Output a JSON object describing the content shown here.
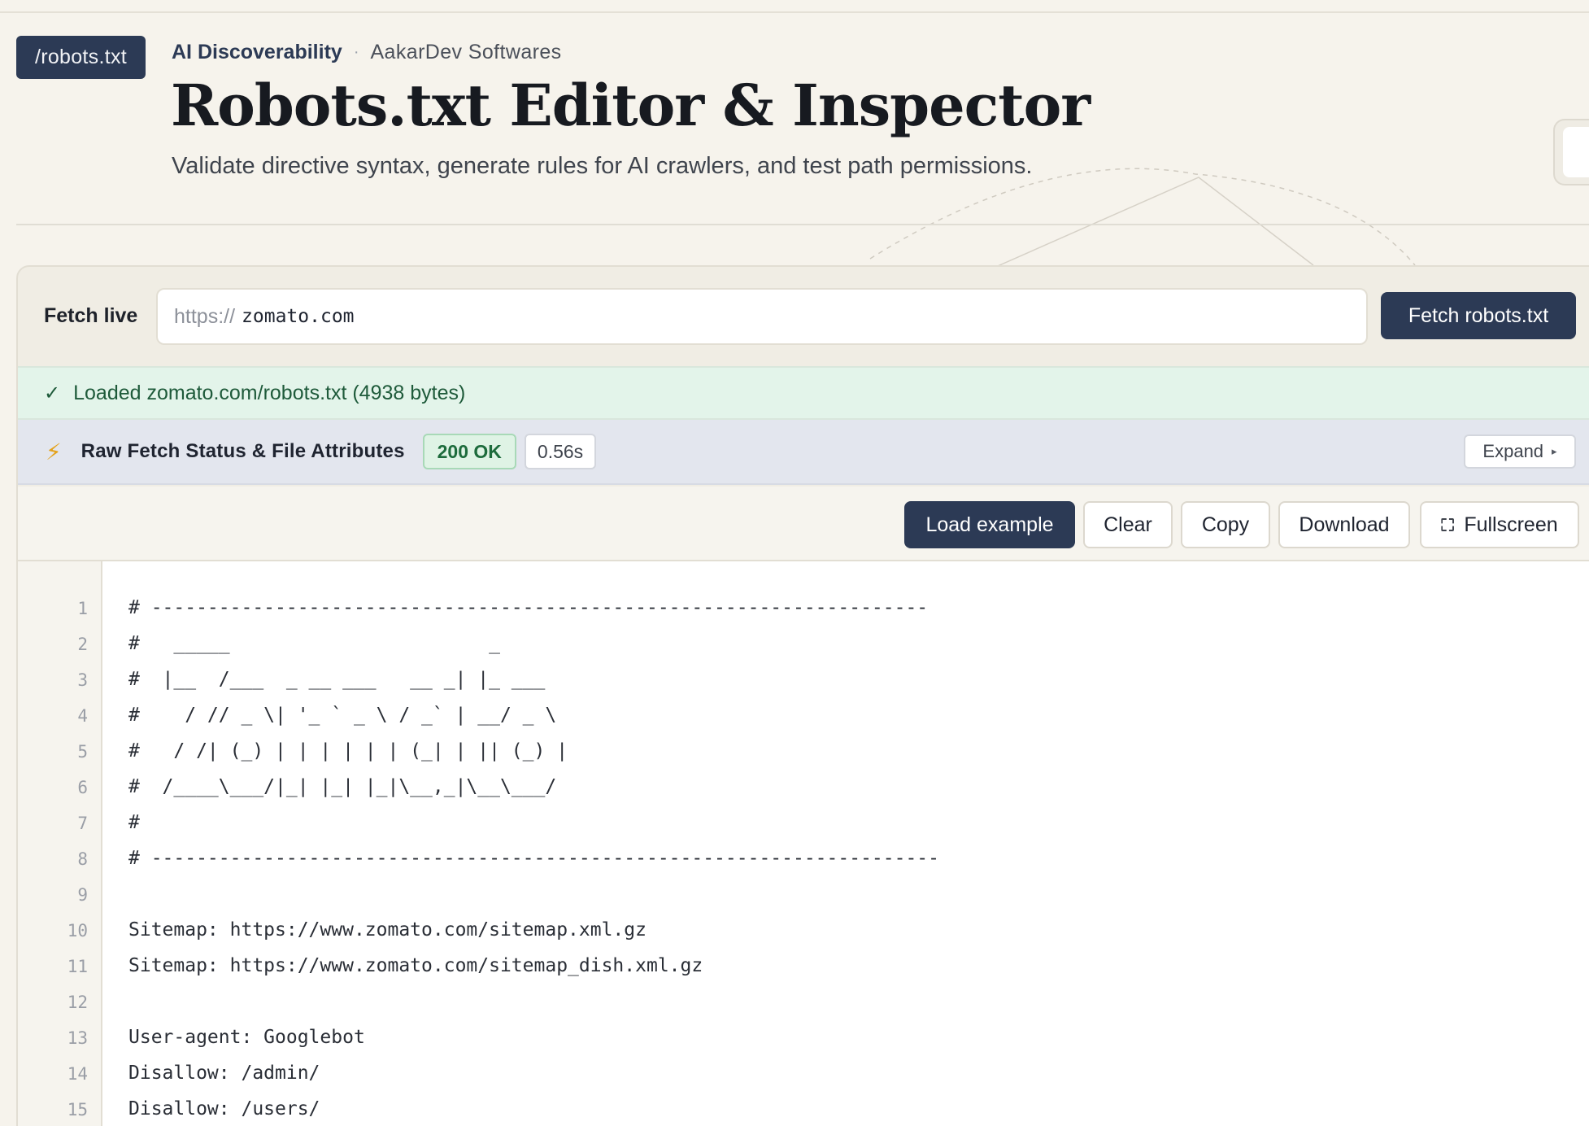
{
  "header": {
    "badge": "/robots.txt",
    "crumb_primary": "AI Discoverability",
    "crumb_separator": "·",
    "crumb_secondary": "AakarDev Softwares",
    "title": "Robots.txt Editor & Inspector",
    "subtitle": "Validate directive syntax, generate rules for AI crawlers, and test path permissions."
  },
  "fetch": {
    "label": "Fetch live",
    "prefix": "https://",
    "value": "zomato.com",
    "button": "Fetch robots.txt"
  },
  "success": {
    "icon": "check-icon",
    "message": "Loaded zomato.com/robots.txt (4938 bytes)"
  },
  "status": {
    "icon": "lightning-bolt-icon",
    "title": "Raw Fetch Status & File Attributes",
    "code": "200 OK",
    "time": "0.56s",
    "expand_label": "Expand",
    "expand_caret": "▸"
  },
  "toolbar": {
    "load_example": "Load example",
    "clear": "Clear",
    "copy": "Copy",
    "download": "Download",
    "fullscreen": "Fullscreen"
  },
  "editor": {
    "line_numbers": [
      "1",
      "2",
      "3",
      "4",
      "5",
      "6",
      "7",
      "8",
      "9",
      "10",
      "11",
      "12",
      "13",
      "14",
      "15"
    ],
    "lines": [
      "# ---------------------------------------------------------------------",
      "#   _____                       _",
      "#  |__  /___  _ __ ___   __ _| |_ ___",
      "#    / // _ \\| '_ ` _ \\ / _` | __/ _ \\",
      "#   / /| (_) | | | | | | (_| | || (_) |",
      "#  /____\\___/|_| |_| |_|\\__,_|\\__\\___/",
      "#",
      "# ----------------------------------------------------------------------",
      "",
      "Sitemap: https://www.zomato.com/sitemap.xml.gz",
      "Sitemap: https://www.zomato.com/sitemap_dish.xml.gz",
      "",
      "User-agent: Googlebot",
      "Disallow: /admin/",
      "Disallow: /users/"
    ]
  },
  "colors": {
    "primary": "#2c3a55",
    "background": "#f6f3ec",
    "success_bg": "#e3f4ea",
    "status_bg": "#e3e6ee",
    "bolt": "#e4a21b"
  }
}
